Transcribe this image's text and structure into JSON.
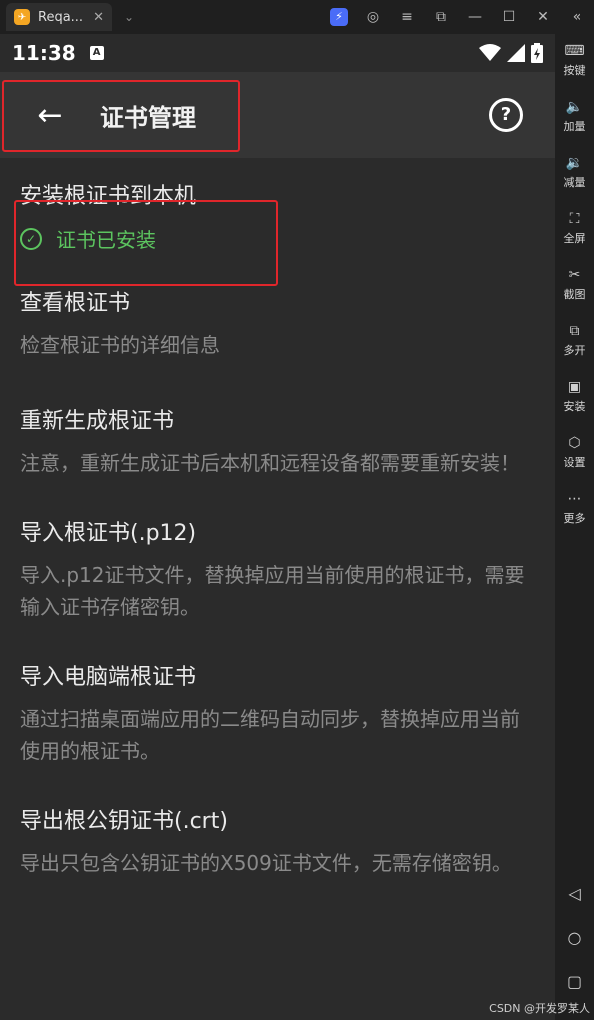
{
  "window": {
    "tab_title": "Reqa...",
    "tab_close": "✕",
    "dropdown": "⌄",
    "controls": [
      "◎",
      "≡",
      "⧉",
      "—",
      "☐",
      "✕",
      "«"
    ]
  },
  "status_bar": {
    "time": "11:38",
    "a_icon": "A"
  },
  "app_bar": {
    "back_icon": "←",
    "title": "证书管理",
    "help_icon": "?"
  },
  "items": [
    {
      "title": "安装根证书到本机",
      "status": "证书已安装"
    },
    {
      "title": "查看根证书",
      "desc": "检查根证书的详细信息"
    },
    {
      "title": "重新生成根证书",
      "desc": "注意，重新生成证书后本机和远程设备都需要重新安装！"
    },
    {
      "title": "导入根证书(.p12)",
      "desc": "导入.p12证书文件，替换掉应用当前使用的根证书，需要输入证书存储密钥。"
    },
    {
      "title": "导入电脑端根证书",
      "desc": "通过扫描桌面端应用的二维码自动同步，替换掉应用当前使用的根证书。"
    },
    {
      "title": "导出根公钥证书(.crt)",
      "desc": "导出只包含公钥证书的X509证书文件，无需存储密钥。"
    }
  ],
  "sidebar": [
    {
      "icon": "keyboard-icon",
      "glyph": "⌨",
      "label": "按键"
    },
    {
      "icon": "volume-up-icon",
      "glyph": "🔈",
      "label": "加量"
    },
    {
      "icon": "volume-down-icon",
      "glyph": "🔉",
      "label": "减量"
    },
    {
      "icon": "fullscreen-icon",
      "glyph": "⛶",
      "label": "全屏"
    },
    {
      "icon": "scissors-icon",
      "glyph": "✂",
      "label": "截图"
    },
    {
      "icon": "multi-open-icon",
      "glyph": "⧉",
      "label": "多开"
    },
    {
      "icon": "apk-icon",
      "glyph": "▣",
      "label": "安装"
    },
    {
      "icon": "settings-icon",
      "glyph": "⬡",
      "label": "设置"
    },
    {
      "icon": "more-icon",
      "glyph": "⋯",
      "label": "更多"
    }
  ],
  "nav": {
    "back": "◁",
    "home": "○",
    "recents": "▢"
  },
  "watermark": "CSDN @开发罗某人",
  "colors": {
    "accent_green": "#5cc45f",
    "highlight_red": "#e0262b",
    "background": "#2b2b2b"
  }
}
